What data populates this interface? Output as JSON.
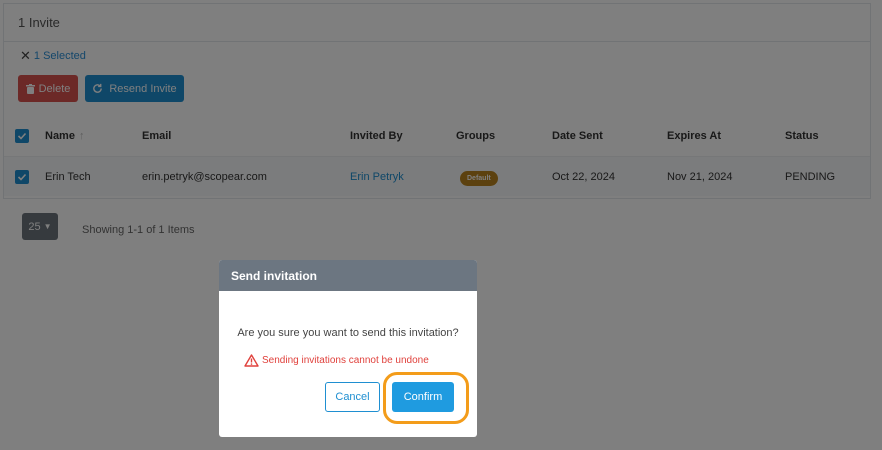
{
  "panel": {
    "title": "1 Invite"
  },
  "selection": {
    "label": "1 Selected"
  },
  "toolbar": {
    "delete_label": "Delete",
    "resend_label": "Resend Invite"
  },
  "table": {
    "columns": [
      "Name",
      "Email",
      "Invited By",
      "Groups",
      "Date Sent",
      "Expires At",
      "Status"
    ],
    "rows": [
      {
        "name": "Erin Tech",
        "email": "erin.petryk@scopear.com",
        "invited_by": "Erin Petryk",
        "group": "Default",
        "date_sent": "Oct 22, 2024",
        "expires_at": "Nov 21, 2024",
        "status": "PENDING"
      }
    ]
  },
  "pagination": {
    "page_size": "25",
    "summary": "Showing 1-1 of 1 Items"
  },
  "modal": {
    "title": "Send invitation",
    "message": "Are you sure you want to send this invitation?",
    "warning": "Sending invitations cannot be undone",
    "cancel_label": "Cancel",
    "confirm_label": "Confirm"
  },
  "colors": {
    "primary": "#1f8fd1",
    "danger": "#d9534f",
    "warning_text": "#e0413c",
    "badge": "#b8831f",
    "highlight": "#f39c1a"
  }
}
